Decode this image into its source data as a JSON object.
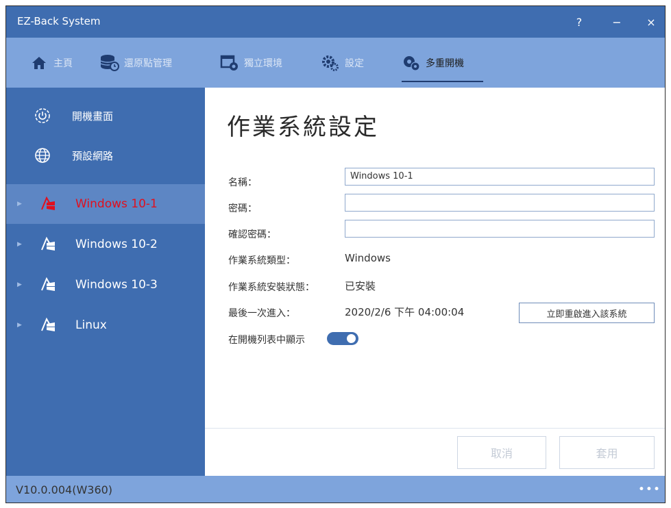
{
  "window": {
    "title": "EZ-Back System",
    "help": "?",
    "minimize": "−",
    "close": "×"
  },
  "nav": {
    "items": [
      {
        "label": "主頁",
        "icon": "home-icon"
      },
      {
        "label": "還原點管理",
        "icon": "database-restore-icon"
      },
      {
        "label": "獨立環境",
        "icon": "window-record-icon"
      },
      {
        "label": "設定",
        "icon": "gears-icon"
      },
      {
        "label": "多重開機",
        "icon": "multi-gear-icon",
        "active": true
      }
    ]
  },
  "sidebar": {
    "items": [
      {
        "label": "開機畫面",
        "icon": "gear-power-icon"
      },
      {
        "label": "預設網路",
        "icon": "globe-icon"
      },
      {
        "label": "Windows 10-1",
        "icon": "os-windows-icon",
        "selected": true
      },
      {
        "label": "Windows 10-2",
        "icon": "os-windows-icon"
      },
      {
        "label": "Windows 10-3",
        "icon": "os-windows-icon"
      },
      {
        "label": "Linux",
        "icon": "os-windows-icon"
      }
    ]
  },
  "form": {
    "title": "作業系統設定",
    "name_label": "名稱：",
    "name_value": "Windows 10-1",
    "password_label": "密碼：",
    "password_value": "",
    "confirm_label": "確認密碼：",
    "confirm_value": "",
    "os_type_label": "作業系統類型：",
    "os_type_value": "Windows",
    "install_status_label": "作業系統安裝狀態：",
    "install_status_value": "已安裝",
    "last_entry_label": "最後一次進入：",
    "last_entry_value": "2020/2/6 下午 04:00:04",
    "reboot_button": "立即重啟進入該系統",
    "show_in_list_label": "在開機列表中顯示",
    "show_in_list_on": true,
    "cancel_button": "取消",
    "apply_button": "套用"
  },
  "status": {
    "version": "V10.0.004(W360)",
    "more": "•••"
  },
  "colors": {
    "dark_blue": "#3f6db0",
    "light_blue": "#7ea4dc",
    "selected_bg": "#5d86c4",
    "selected_text": "#e0101e"
  }
}
